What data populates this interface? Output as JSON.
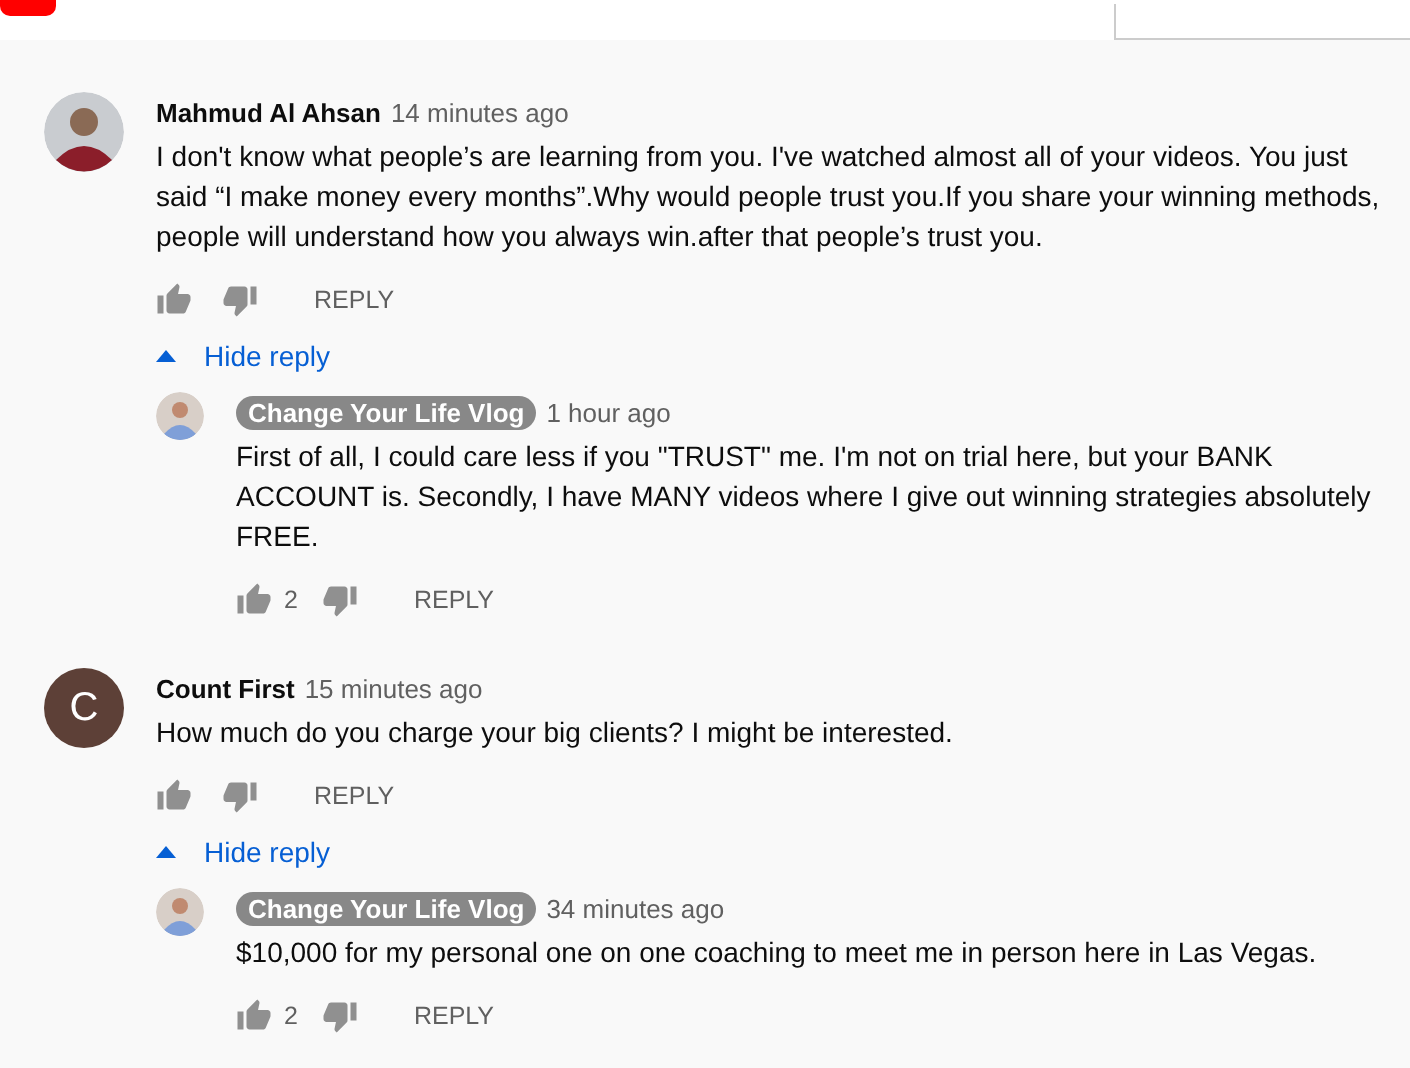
{
  "threads": [
    {
      "author": "Mahmud Al Ahsan",
      "time": "14 minutes ago",
      "avatar": {
        "kind": "photo"
      },
      "text": "I don't know what people’s are learning from you. I've watched almost all of your videos. You just said “I make money every months”.Why would people trust you.If you share your winning methods, people will understand how you always win.after that people’s trust you.",
      "reply_action": "REPLY",
      "toggle": "Hide reply",
      "expanded": true,
      "replies": [
        {
          "author": "Change Your Life Vlog",
          "owner": true,
          "time": "1 hour ago",
          "text": "First of all, I could care less if you \"TRUST\" me. I'm not on trial here, but your BANK ACCOUNT is. Secondly, I have MANY videos where I give out winning strategies absolutely FREE.",
          "likes": "2",
          "reply_action": "REPLY"
        }
      ]
    },
    {
      "author": "Count First",
      "time": "15 minutes ago",
      "avatar": {
        "kind": "letter",
        "letter": "C",
        "color": "#5d4037"
      },
      "text": "How much do you charge your big clients? I might be interested.",
      "reply_action": "REPLY",
      "toggle": "Hide reply",
      "expanded": true,
      "replies": [
        {
          "author": "Change Your Life Vlog",
          "owner": true,
          "time": "34 minutes ago",
          "text": "$10,000 for my personal one on one coaching to meet me in person here in Las Vegas.",
          "likes": "2",
          "reply_action": "REPLY"
        }
      ]
    }
  ]
}
